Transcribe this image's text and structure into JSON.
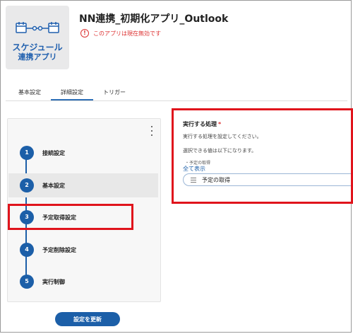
{
  "app": {
    "icon_line1": "スケジュール",
    "icon_line2": "連携アプリ",
    "title": "NN連携_初期化アプリ_Outlook",
    "status_text": "このアプリは現在無効です",
    "status_color": "#dd3333"
  },
  "tabs": [
    {
      "label": "基本設定",
      "active": false
    },
    {
      "label": "詳細設定",
      "active": true
    },
    {
      "label": "トリガー",
      "active": false
    }
  ],
  "steps": [
    {
      "num": "1",
      "label": "接続設定",
      "selected": false
    },
    {
      "num": "2",
      "label": "基本設定",
      "selected": true
    },
    {
      "num": "3",
      "label": "予定取得設定",
      "selected": false
    },
    {
      "num": "4",
      "label": "予定削除設定",
      "selected": false
    },
    {
      "num": "5",
      "label": "実行制御",
      "selected": false
    }
  ],
  "update_button": "設定を更新",
  "detail": {
    "field_title": "実行する処理",
    "required_mark": "*",
    "help1": "実行する処理を設定してください。",
    "help2": "選択できる値は以下になります。",
    "bullet": "・予定の取得",
    "show_all": "全て表示",
    "selected_value": "予定の取得"
  },
  "colors": {
    "accent": "#1c5fa8",
    "highlight": "#e0141c"
  },
  "icons": {
    "app_icon": "calendar-link-icon",
    "warning": "warning-circle-icon",
    "menu": "kebab-menu-icon",
    "select": "list-icon"
  }
}
